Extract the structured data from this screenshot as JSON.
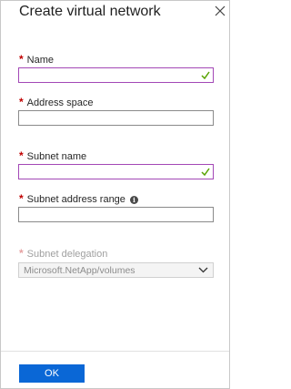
{
  "dialog": {
    "title": "Create virtual network",
    "close_icon": "close-icon"
  },
  "fields": {
    "name": {
      "required_mark": "*",
      "label": "Name",
      "value": "",
      "valid": true
    },
    "address_space": {
      "required_mark": "*",
      "label": "Address space",
      "value": ""
    },
    "subnet_name": {
      "required_mark": "*",
      "label": "Subnet name",
      "value": "",
      "valid": true
    },
    "subnet_address_range": {
      "required_mark": "*",
      "label": "Subnet address range",
      "info_glyph": "i",
      "value": ""
    },
    "subnet_delegation": {
      "required_mark": "*",
      "label": "Subnet delegation",
      "selected": "Microsoft.NetApp/volumes",
      "disabled": true
    }
  },
  "footer": {
    "ok_label": "OK"
  },
  "colors": {
    "accent": "#0a67d6",
    "required": "#c00000",
    "valid_border": "#a348b6",
    "valid_check": "#57a300"
  }
}
